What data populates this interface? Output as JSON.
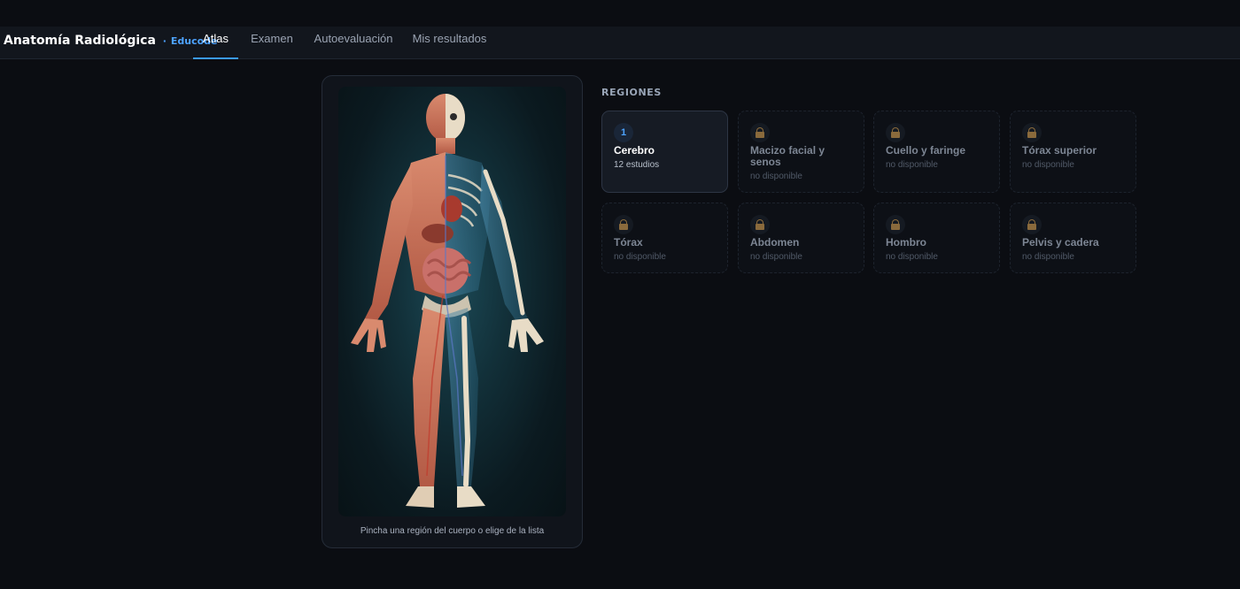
{
  "app": {
    "title": "Anatomía Radiológica",
    "separator": "·",
    "org": "Educode"
  },
  "nav": {
    "tabs": [
      {
        "label": "Atlas",
        "active": true
      },
      {
        "label": "Examen",
        "active": false
      },
      {
        "label": "Autoevaluación",
        "active": false
      },
      {
        "label": "Mis resultados",
        "active": false
      }
    ]
  },
  "atlas": {
    "hint": "Pincha una región del cuerpo o elige de la lista"
  },
  "regions": {
    "title": "REGIONES",
    "items": [
      {
        "badge": "1",
        "name": "Cerebro",
        "status": "12 estudios",
        "available": true
      },
      {
        "name": "Macizo facial y senos",
        "status": "no disponible",
        "available": false
      },
      {
        "name": "Cuello y faringe",
        "status": "no disponible",
        "available": false
      },
      {
        "name": "Tórax superior",
        "status": "no disponible",
        "available": false
      },
      {
        "name": "Tórax",
        "status": "no disponible",
        "available": false
      },
      {
        "name": "Abdomen",
        "status": "no disponible",
        "available": false
      },
      {
        "name": "Hombro",
        "status": "no disponible",
        "available": false
      },
      {
        "name": "Pelvis y cadera",
        "status": "no disponible",
        "available": false
      }
    ]
  },
  "colors": {
    "accent": "#3b9bff",
    "background": "#0b0d12",
    "lock": "#8a6a3c"
  },
  "icons": {
    "locked": "lock-icon"
  }
}
